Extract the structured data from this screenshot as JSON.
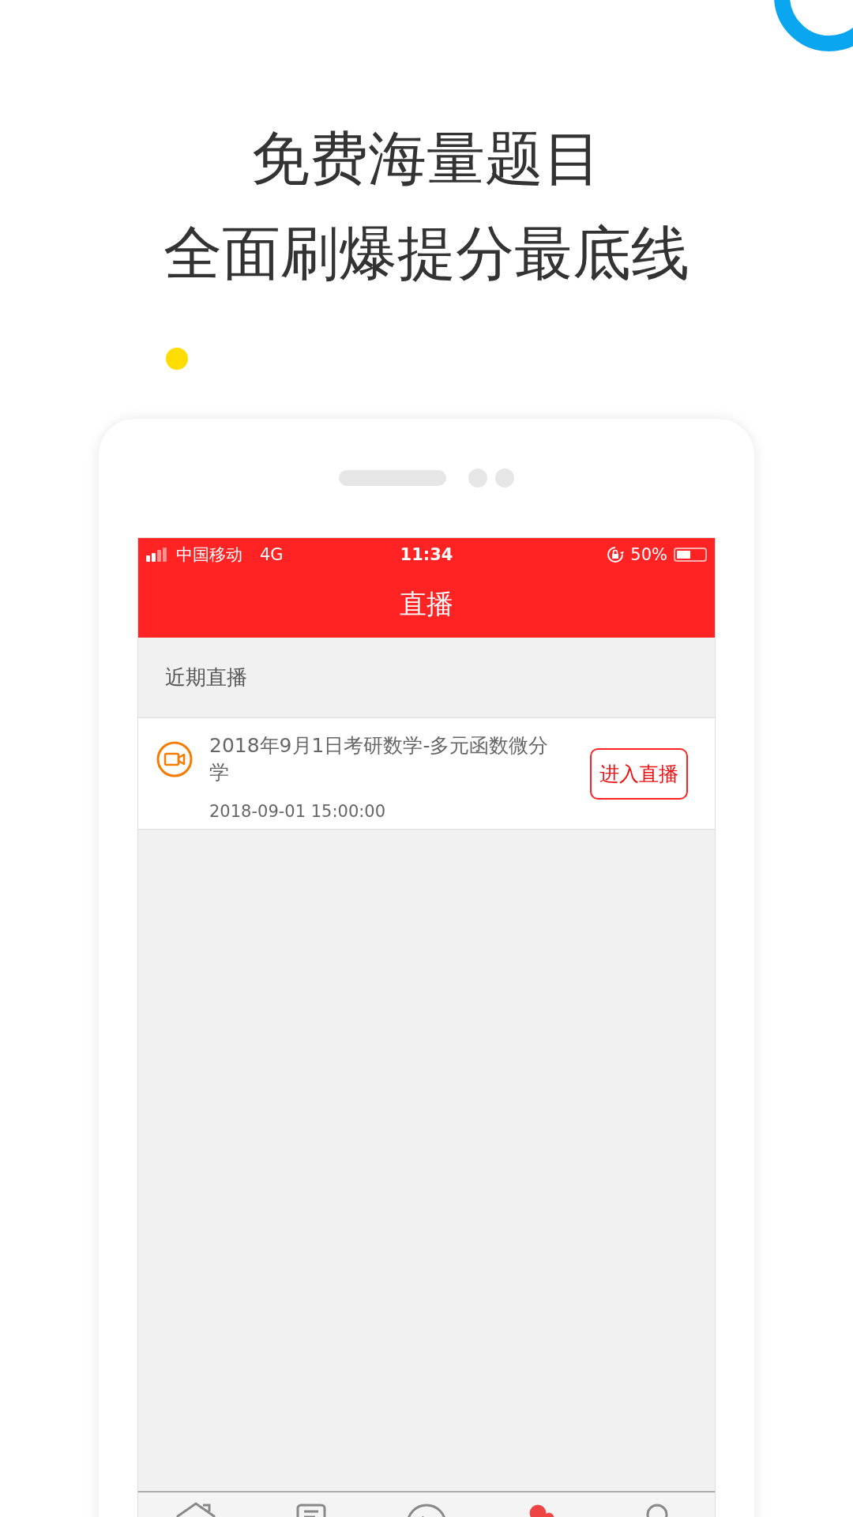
{
  "headline": [
    "免费海量题目",
    "全面刷爆提分最底线"
  ],
  "status_bar": {
    "carrier": "中国移动",
    "network": "4G",
    "time": "11:34",
    "battery": {
      "text": "50%",
      "level": 0.5
    }
  },
  "nav": {
    "title": "直播"
  },
  "section": {
    "title": "近期直播"
  },
  "lives": [
    {
      "title": "2018年9月1日考研数学-多元函数微分学",
      "time": "2018-09-01 15:00:00",
      "button": "进入直播"
    }
  ],
  "tabs": [
    {
      "selected": false
    },
    {
      "selected": false
    },
    {
      "selected": false
    },
    {
      "selected": true
    },
    {
      "selected": false
    }
  ]
}
